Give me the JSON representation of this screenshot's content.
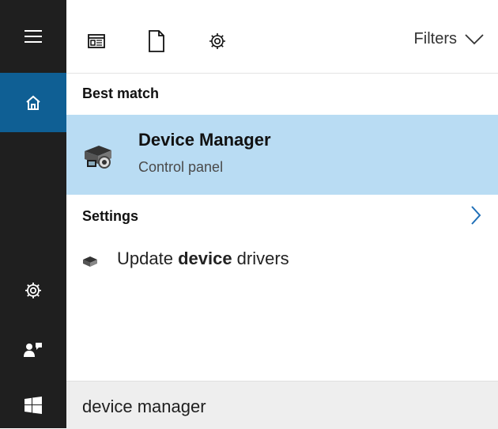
{
  "rail": {
    "items": [
      "hamburger-menu-icon",
      "home-icon",
      "settings-icon",
      "feedback-icon",
      "windows-logo-icon"
    ]
  },
  "toolbar": {
    "filters_label": "Filters"
  },
  "results": {
    "best_match_label": "Best match",
    "best_match": {
      "title": "Device Manager",
      "subtitle": "Control panel"
    },
    "settings_label": "Settings",
    "settings_items": [
      {
        "prefix": "Update ",
        "highlight": "device",
        "suffix": " drivers"
      }
    ]
  },
  "search": {
    "query": "device manager"
  },
  "colors": {
    "rail_bg": "#1f1f1f",
    "rail_active": "#0f5f94",
    "selection": "#b9dcf3",
    "searchbar_bg": "#eeeeee"
  }
}
